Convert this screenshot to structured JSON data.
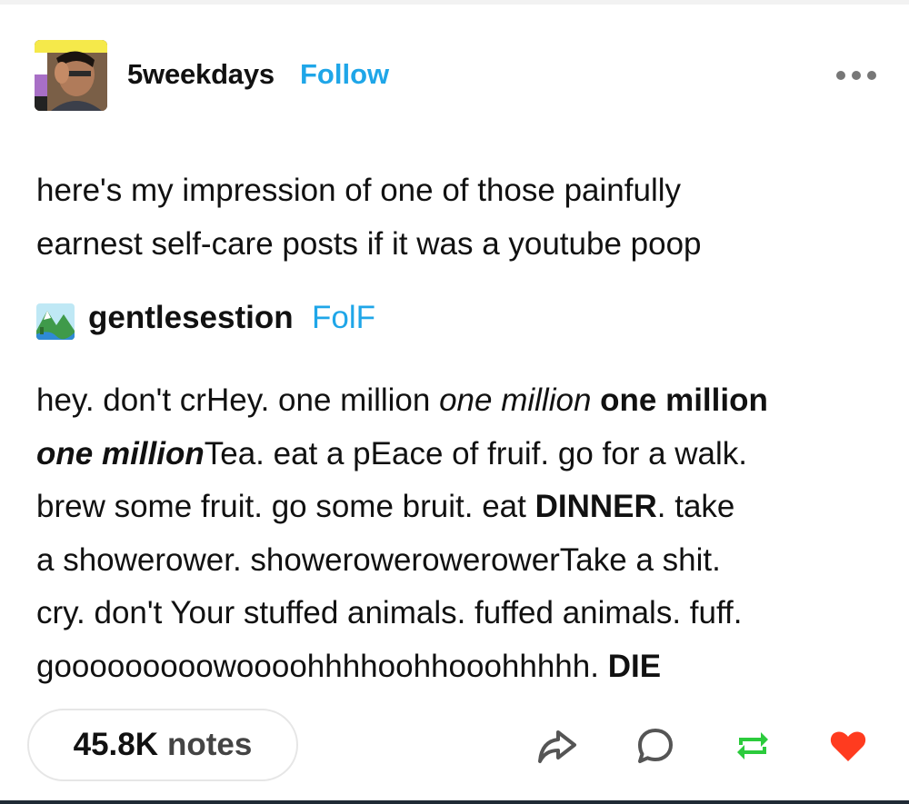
{
  "post": {
    "author": "5weekdays",
    "follow_label": "Follow",
    "more_icon": "more-horizontal-icon",
    "text_lines": [
      "here's my impression of one of those painfully",
      "earnest self-care posts if it was a youtube poop"
    ]
  },
  "reblog": {
    "author": "gentlesestion",
    "follow_label": "FolF",
    "icon": "landscape-avatar",
    "lines": [
      {
        "a": "hey. don't crHey. one million ",
        "b": "one million",
        "c": " ",
        "d": "one million"
      },
      {
        "a": "one million",
        "b": "Tea. eat a pEace of fruif. go for a walk."
      },
      {
        "a": "brew some fruit. go some bruit. eat ",
        "b": "DINNER",
        "c": ". take"
      },
      {
        "a": "a showerower. showerowerowerowerTake a shit."
      },
      {
        "a": "cry. don't Your stuffed animals. fuffed animals. fuff."
      },
      {
        "a": "gooooooooowoooohhhhoohhooohhhhh. ",
        "b": "DIE"
      }
    ]
  },
  "footer": {
    "notes_count": "45.8K",
    "notes_label": "notes",
    "icons": [
      "share-icon",
      "reply-icon",
      "reblog-icon",
      "like-icon"
    ]
  },
  "colors": {
    "accent": "#1fa6e8",
    "reblog_green": "#2bcb3c",
    "like_red": "#ff3b1f"
  }
}
